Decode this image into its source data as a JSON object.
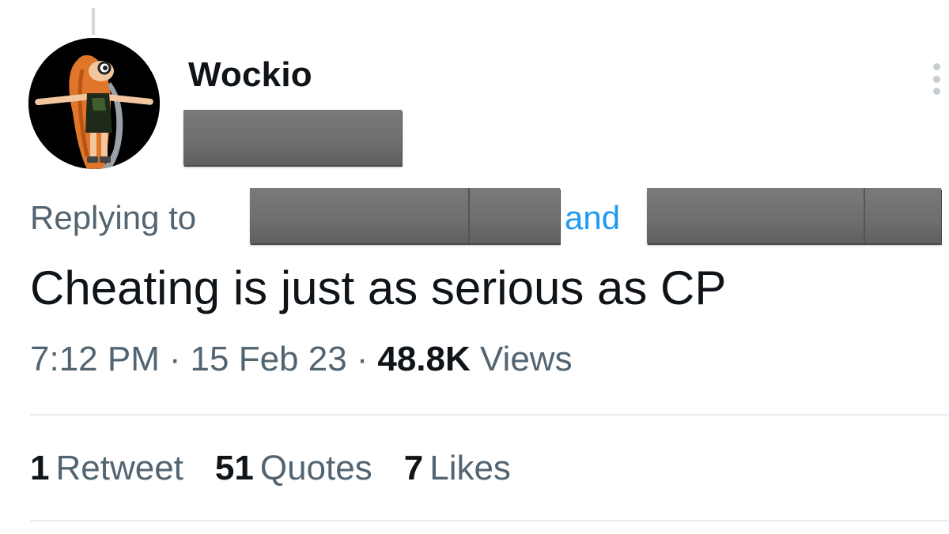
{
  "author": {
    "display_name": "Wockio",
    "avatar_icon": "avatar-image"
  },
  "reply": {
    "prefix": "Replying to",
    "conjunction": "and",
    "link_color": "#1d9bf0"
  },
  "tweet": {
    "text": "Cheating is just as serious as CP",
    "time": "7:12 PM",
    "date": "15 Feb 23",
    "separator": "·",
    "views_count": "48.8K",
    "views_label": "Views"
  },
  "stats": [
    {
      "count": "1",
      "label": "Retweet"
    },
    {
      "count": "51",
      "label": "Quotes"
    },
    {
      "count": "7",
      "label": "Likes"
    }
  ],
  "icons": {
    "more": "more-options-icon"
  },
  "colors": {
    "text": "#0f1419",
    "secondary": "#536471",
    "divider": "#e6ecf0"
  }
}
